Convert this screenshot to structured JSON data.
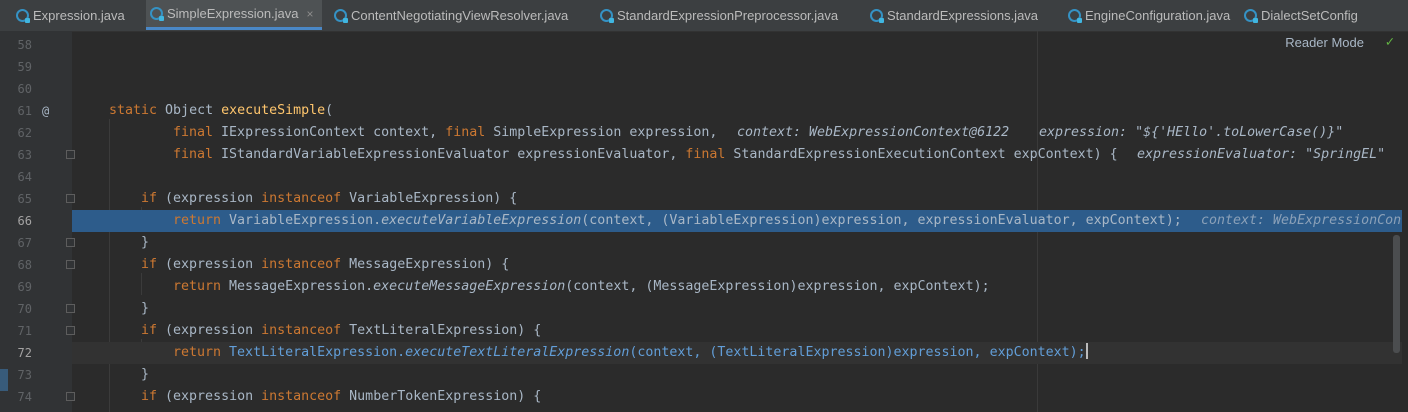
{
  "tabs": [
    {
      "label": "Expression.java",
      "active": false,
      "closable": false
    },
    {
      "label": "SimpleExpression.java",
      "active": true,
      "closable": true
    },
    {
      "label": "ContentNegotiatingViewResolver.java",
      "active": false,
      "closable": false
    },
    {
      "label": "StandardExpressionPreprocessor.java",
      "active": false,
      "closable": false
    },
    {
      "label": "StandardExpressions.java",
      "active": false,
      "closable": false
    },
    {
      "label": "EngineConfiguration.java",
      "active": false,
      "closable": false
    },
    {
      "label": "DialectSetConfig",
      "active": false,
      "closable": false
    }
  ],
  "tab_close_glyph": "×",
  "editor": {
    "reader_mode_label": "Reader Mode",
    "line_numbers": [
      "58",
      "59",
      "60",
      "61",
      "62",
      "63",
      "64",
      "65",
      "66",
      "67",
      "68",
      "69",
      "70",
      "71",
      "72",
      "73",
      "74"
    ],
    "override_marker": "@",
    "code": {
      "l61_kw": "static ",
      "l61_type": "Object ",
      "l61_fn": "executeSimple",
      "l61_rest": "(",
      "l62_kw1": "final ",
      "l62_a": "IExpressionContext context, ",
      "l62_kw2": "final ",
      "l62_b": "SimpleExpression expression,",
      "l62_hint1": "context: WebExpressionContext@6122",
      "l62_hint2": "expression: \"${'HEllo'.toLowerCase()}\"",
      "l63_kw1": "final ",
      "l63_a": "IStandardVariableExpressionEvaluator expressionEvaluator, ",
      "l63_kw2": "final ",
      "l63_b": "StandardExpressionExecutionContext expContext) {",
      "l63_hint": "expressionEvaluator: \"SpringEL\"",
      "l65_kw1": "if ",
      "l65_a": "(expression ",
      "l65_kw2": "instanceof ",
      "l65_b": "VariableExpression) {",
      "l66_kw": "return ",
      "l66_cls": "VariableExpression.",
      "l66_fn": "executeVariableExpression",
      "l66_rest": "(context, (VariableExpression)expression, expressionEvaluator, expContext);",
      "l66_hint": "context: WebExpressionCon",
      "l67": "}",
      "l68_kw1": "if ",
      "l68_a": "(expression ",
      "l68_kw2": "instanceof ",
      "l68_b": "MessageExpression) {",
      "l69_kw": "return ",
      "l69_cls": "MessageExpression.",
      "l69_fn": "executeMessageExpression",
      "l69_rest": "(context, (MessageExpression)expression, expContext);",
      "l70": "}",
      "l71_kw1": "if ",
      "l71_a": "(expression ",
      "l71_kw2": "instanceof ",
      "l71_b": "TextLiteralExpression) {",
      "l72_kw": "return ",
      "l72_cls": "TextLiteralExpression.",
      "l72_fn": "executeTextLiteralExpression",
      "l72_rest": "(context, (TextLiteralExpression)expression, expContext);",
      "l73": "}",
      "l74_kw1": "if ",
      "l74_a": "(expression ",
      "l74_kw2": "instanceof ",
      "l74_b": "NumberTokenExpression) {"
    }
  },
  "colors": {
    "keyword": "#cc7832",
    "function": "#ffc66d",
    "plain": "#a9b7c6",
    "hint": "#787878",
    "execution_line": "#2d5c8b",
    "tab_accent": "#4a88c7"
  },
  "icons": {
    "tab_icon": "java-class-icon",
    "reader_mode_check": "check-icon"
  }
}
